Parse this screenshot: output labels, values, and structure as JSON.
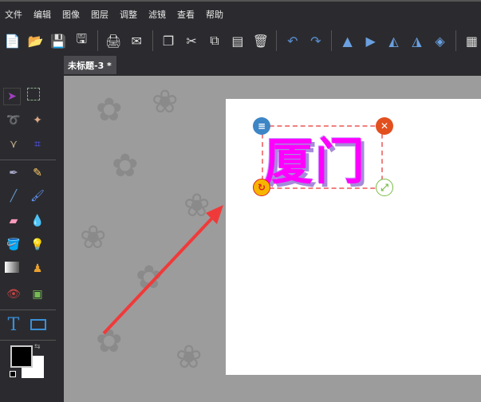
{
  "menu": [
    "文件",
    "编辑",
    "图像",
    "图层",
    "调整",
    "滤镜",
    "查看",
    "帮助"
  ],
  "toolbar": [
    [
      "new-file",
      "📄"
    ],
    [
      "open-folder",
      "📂"
    ],
    [
      "save",
      "💾"
    ],
    [
      "save-as",
      "🖫"
    ],
    "sep",
    [
      "print",
      "🖨"
    ],
    [
      "email",
      "✉"
    ],
    "sep",
    [
      "duplicate",
      "❐"
    ],
    [
      "cut",
      "✂"
    ],
    [
      "copy",
      "⧉"
    ],
    [
      "paste",
      "▤"
    ],
    [
      "delete",
      "🗑"
    ],
    "sep",
    [
      "undo",
      "↶"
    ],
    [
      "redo",
      "↷"
    ],
    "sep",
    [
      "flip-horizontal",
      "▲"
    ],
    [
      "flip-vertical",
      "▶"
    ],
    [
      "rotate-left",
      "◭"
    ],
    [
      "rotate-right",
      "◮"
    ],
    [
      "rotate",
      "◈"
    ],
    "sep",
    [
      "grid",
      "▦"
    ]
  ],
  "tab": {
    "title": "未标题-3 *"
  },
  "canvas": {
    "text": "厦门",
    "accent": "#ff00ff"
  }
}
